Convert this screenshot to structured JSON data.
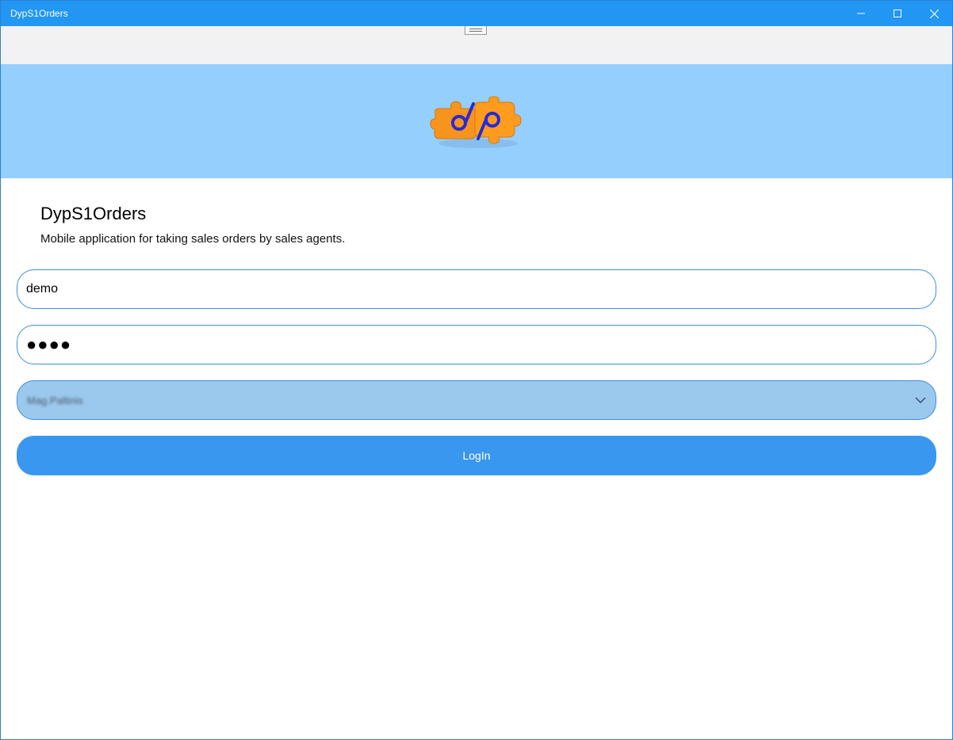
{
  "window": {
    "title": "DypS1Orders",
    "controls": {
      "minimize_icon": "minimize-icon",
      "maximize_icon": "maximize-icon",
      "close_icon": "close-icon"
    }
  },
  "colors": {
    "titlebar": "#2196f3",
    "banner": "#95cffe",
    "accent": "#3a97ef",
    "field_border": "#3a8ee6",
    "select_bg": "#9bc9ee"
  },
  "banner": {
    "logo_icon": "puzzle-logo-icon"
  },
  "app": {
    "heading": "DypS1Orders",
    "description": "Mobile application for taking sales orders by sales agents."
  },
  "login": {
    "username_value": "demo",
    "password_masked": "●●●●",
    "store_selected": "Mag.Paltinis",
    "login_label": "LogIn"
  }
}
